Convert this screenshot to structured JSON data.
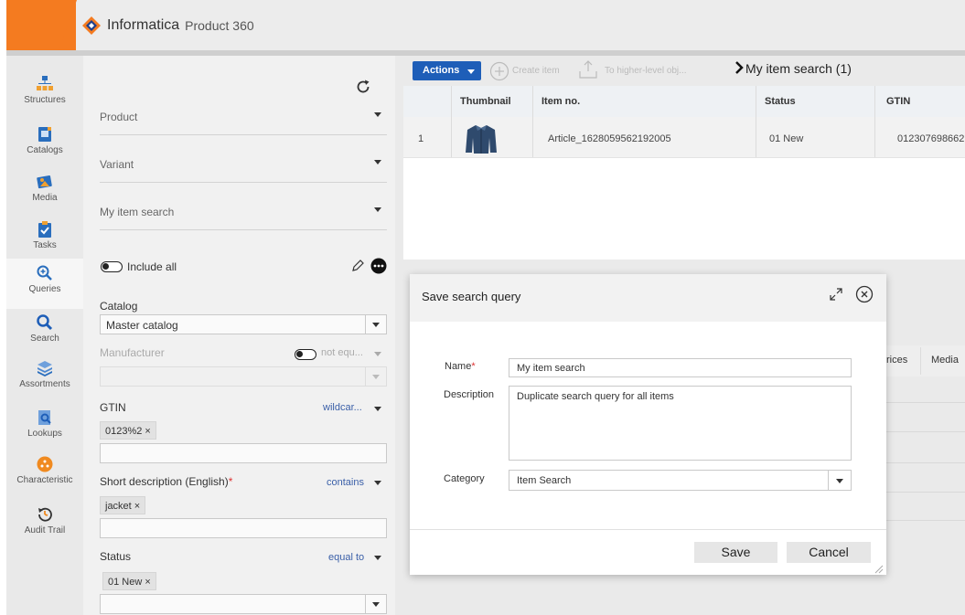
{
  "app": {
    "brand": "Informatica",
    "product": "Product 360",
    "colors": {
      "accent_orange": "#f47b20",
      "primary_blue": "#1e5eb8"
    }
  },
  "nav": {
    "items": [
      {
        "label": "Structures",
        "icon": "structures-icon"
      },
      {
        "label": "Catalogs",
        "icon": "catalogs-icon"
      },
      {
        "label": "Media",
        "icon": "media-icon"
      },
      {
        "label": "Tasks",
        "icon": "tasks-icon"
      },
      {
        "label": "Queries",
        "icon": "queries-icon"
      },
      {
        "label": "Search",
        "icon": "search-icon"
      },
      {
        "label": "Assortments",
        "icon": "assortments-icon"
      },
      {
        "label": "Lookups",
        "icon": "lookups-icon"
      },
      {
        "label": "Characteristic",
        "icon": "characteristic-icon"
      },
      {
        "label": "Audit Trail",
        "icon": "audit-trail-icon"
      }
    ]
  },
  "filter": {
    "product_label": "Product",
    "variant_label": "Variant",
    "search_label": "My item search",
    "include_all_label": "Include all",
    "catalog_label": "Catalog",
    "catalog_value": "Master catalog",
    "manufacturer_label": "Manufacturer",
    "manufacturer_op": "not equ...",
    "gtin_label": "GTIN",
    "gtin_op": "wildcar...",
    "gtin_chip": "0123%2 ×",
    "short_desc_label": "Short description (English)",
    "short_desc_required": "*",
    "short_desc_op": "contains",
    "short_desc_chip": "jacket ×",
    "status_label": "Status",
    "status_op": "equal to",
    "status_chip": "01 New ×"
  },
  "toolbar": {
    "actions_label": "Actions",
    "create_item_label": "Create item",
    "to_higher_label": "To higher-level obj...",
    "breadcrumb": "My item search (1)"
  },
  "grid": {
    "headers": [
      "Thumbnail",
      "Item no.",
      "Status",
      "GTIN"
    ],
    "rows": [
      {
        "index": "1",
        "item_no": "Article_1628059562192005",
        "status": "01 New",
        "gtin": "012307698662"
      }
    ]
  },
  "lower_tabs": {
    "prices_partial": "rices",
    "media": "Media"
  },
  "dialog": {
    "title": "Save search query",
    "name_label": "Name",
    "name_required": "*",
    "name_value": "My item search",
    "description_label": "Description",
    "description_value": "Duplicate search query for all items",
    "category_label": "Category",
    "category_value": "Item Search",
    "save_label": "Save",
    "cancel_label": "Cancel"
  }
}
